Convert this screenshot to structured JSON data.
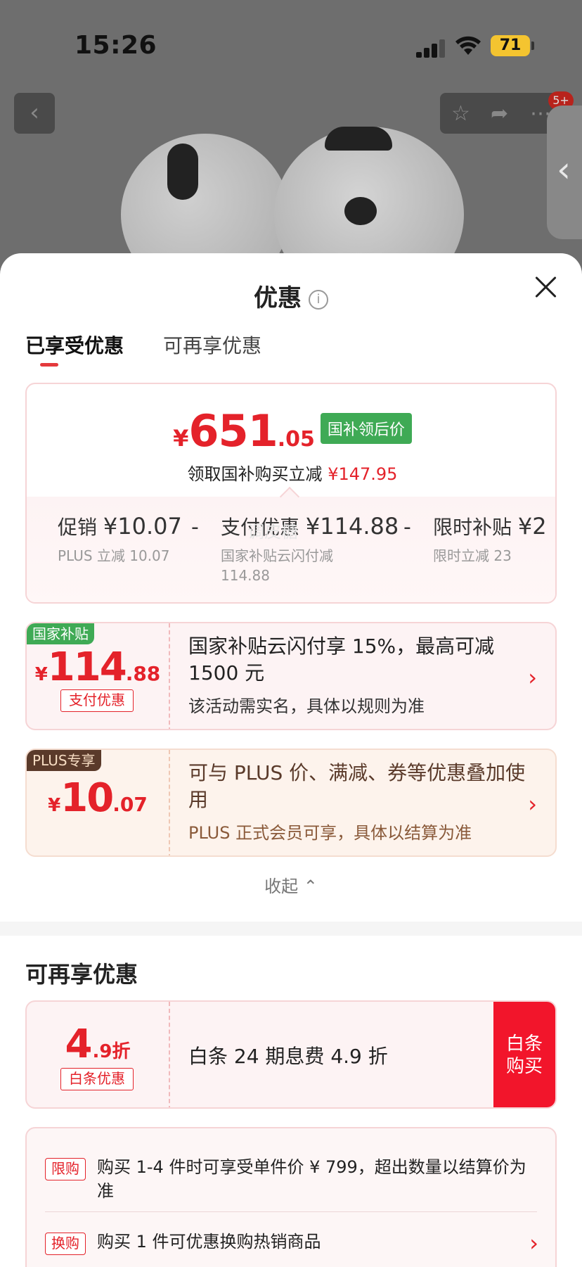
{
  "status": {
    "time": "15:26",
    "battery": "71"
  },
  "header": {
    "back_icon": "chevron-left-icon",
    "cart_badge": "5+"
  },
  "sheet": {
    "title": "优惠",
    "info_icon": "i",
    "tabs": [
      {
        "label": "已享受优惠"
      },
      {
        "label": "可再享优惠"
      }
    ],
    "summary": {
      "currency": "¥",
      "price_int": "651",
      "price_dec": ".05",
      "price_tag": "国补领后价",
      "subline_prefix": "领取国补购买立减",
      "subline_amount": "¥147.95",
      "items": [
        {
          "label": "促销",
          "amount": "¥10.07",
          "desc": "PLUS 立减 10.07"
        },
        {
          "label": "支付优惠",
          "amount": "¥114.88",
          "desc": "国家补贴云闪付减\n114.88"
        },
        {
          "label": "限时补贴",
          "amount": "¥2",
          "desc": "限时立减 23"
        }
      ],
      "minus": "-"
    },
    "watermark": "调皮糖",
    "deals": [
      {
        "corner": "国家补贴",
        "yen": "¥",
        "amount_int": "114",
        "amount_dec": ".88",
        "pill": "支付优惠",
        "line1": "国家补贴云闪付享 15%，最高可减 1500 元",
        "line2": "该活动需实名，具体以规则为准"
      },
      {
        "corner": "PLUS专享",
        "yen": "¥",
        "amount_int": "10",
        "amount_dec": ".07",
        "pill": "",
        "line1": "可与 PLUS 价、满减、券等优惠叠加使用",
        "line2": "PLUS 正式会员可享，具体以结算为准"
      }
    ],
    "collapse_label": "收起 ⌃",
    "section_title": "可再享优惠",
    "baitiao": {
      "amount_int": "4",
      "amount_dec": ".9折",
      "pill": "白条优惠",
      "text": "白条 24 期息费 4.9 折",
      "button": "白条\n购买"
    },
    "rules": [
      {
        "tag": "限购",
        "text": "购买 1-4 件时可享受单件价 ¥ 799，超出数量以结算价为准"
      },
      {
        "tag": "换购",
        "text": "购买 1 件可优惠换购热销商品"
      }
    ],
    "chevron": "›"
  }
}
